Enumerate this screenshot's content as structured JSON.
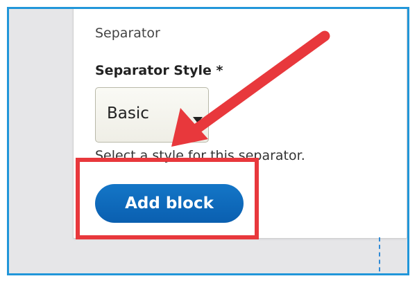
{
  "form": {
    "section_label": "Separator",
    "field_label": "Separator Style *",
    "select": {
      "selected": "Basic"
    },
    "help_text": "Select a style for this separator.",
    "add_block_label": "Add block"
  },
  "annotations": {
    "highlight_color": "#e8383c",
    "frame_color": "#2196d9",
    "icons": [
      "chevron-down-icon",
      "annotation-arrow-icon"
    ]
  }
}
